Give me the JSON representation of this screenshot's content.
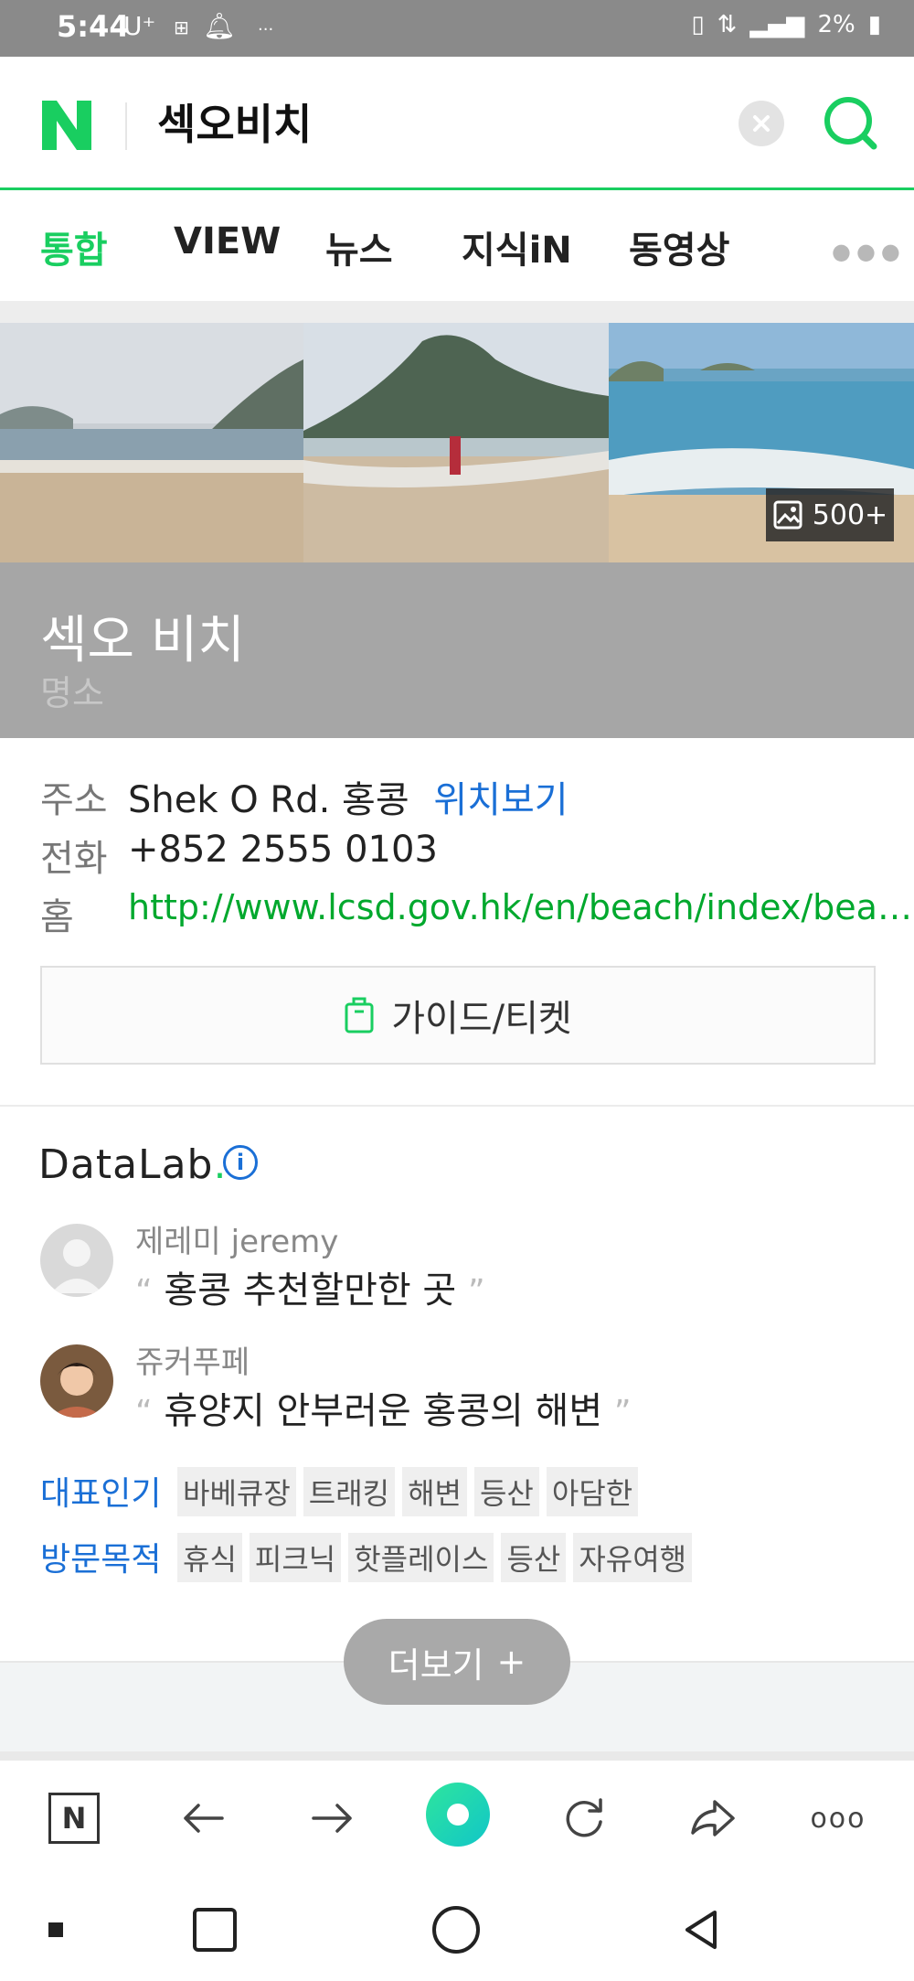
{
  "status_bar": {
    "time": "5:44",
    "carrier": "U⁺",
    "battery": "2%"
  },
  "header": {
    "logo_letter": "N",
    "query": "섹오비치"
  },
  "tabs": [
    {
      "label": "통합",
      "active": true
    },
    {
      "label": "VIEW",
      "active": false
    },
    {
      "label": "뉴스",
      "active": false
    },
    {
      "label": "지식iN",
      "active": false
    },
    {
      "label": "동영상",
      "active": false
    }
  ],
  "photos": {
    "count_label": "500+"
  },
  "place": {
    "name": "섹오 비치",
    "category": "명소"
  },
  "info": {
    "address_label": "주소",
    "address_value": "Shek O Rd. 홍콩",
    "map_link": "위치보기",
    "phone_label": "전화",
    "phone_value": "+852 2555 0103",
    "home_label": "홈",
    "home_value": "http://www.lcsd.gov.hk/en/beach/index/bea…"
  },
  "guide_button": "가이드/티켓",
  "datalab": {
    "title_main": "DataLab",
    "title_dot": ".",
    "info_symbol": "i",
    "reviews": [
      {
        "author": "제레미 jeremy",
        "text": "홍콩 추천할만한 곳"
      },
      {
        "author": "쥬커푸페",
        "text": "휴양지 안부러운 홍콩의 해변"
      }
    ],
    "keyword_rows": [
      {
        "label": "대표인기",
        "chips": [
          "바베큐장",
          "트래킹",
          "해변",
          "등산",
          "아담한"
        ]
      },
      {
        "label": "방문목적",
        "chips": [
          "휴식",
          "피크닉",
          "핫플레이스",
          "등산",
          "자유여행"
        ]
      }
    ]
  },
  "more_button": {
    "label": "더보기",
    "symbol": "+"
  },
  "browser_bar": {
    "items": [
      "naver-home",
      "back",
      "forward",
      "green-dot",
      "refresh",
      "share",
      "more"
    ],
    "home_letter": "N",
    "more_symbol": "ooo"
  },
  "colors": {
    "brand_green": "#19ce60",
    "link_blue": "#1a6fd6",
    "link_green": "#00a82d"
  }
}
